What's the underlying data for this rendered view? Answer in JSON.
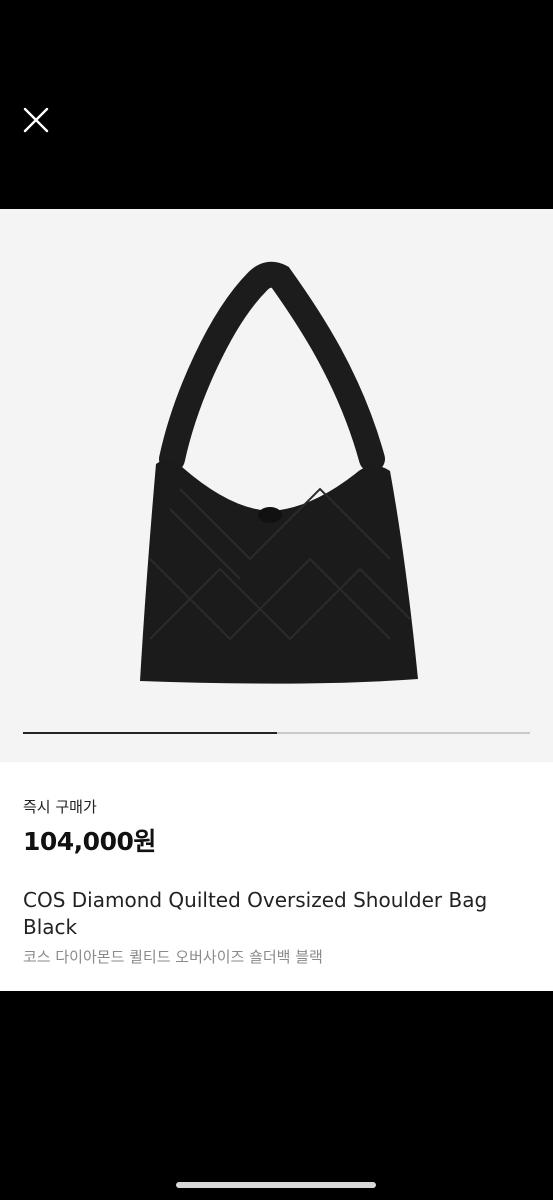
{
  "header": {
    "close_icon": "close-icon"
  },
  "gallery": {
    "image_subject": "bag-image",
    "progress": 0.5
  },
  "product": {
    "price_label": "즉시 구매가",
    "price": "104,000원",
    "title_en": "COS Diamond Quilted Oversized Shoulder Bag Black",
    "title_ko": "코스 다이아몬드 퀼티드 오버사이즈 숄더백 블랙"
  },
  "colors": {
    "background": "#000000",
    "image_bg": "#f4f4f4",
    "text_primary": "#222222",
    "text_secondary": "#8a8a8a"
  }
}
